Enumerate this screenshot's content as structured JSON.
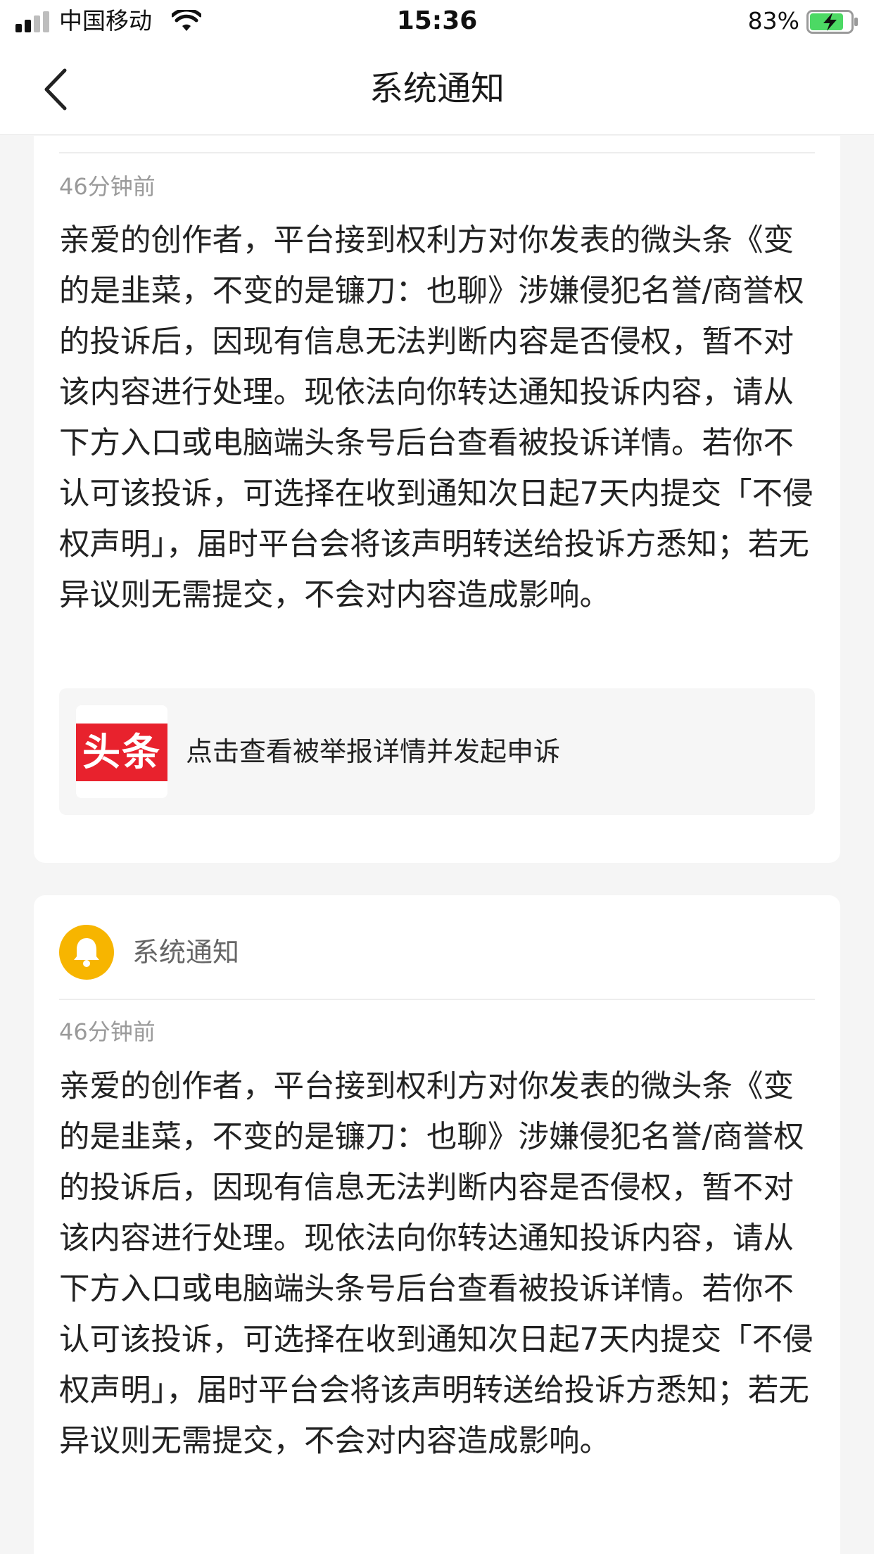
{
  "status_bar": {
    "carrier": "中国移动",
    "time": "15:36",
    "battery_percent": "83%",
    "battery_level": 0.83,
    "signal_bars": 2,
    "charging": true
  },
  "nav": {
    "title": "系统通知",
    "back_icon": "chevron-left-icon"
  },
  "notifications": [
    {
      "time": "46分钟前",
      "body": "亲爱的创作者，平台接到权利方对你发表的微头条《变的是韭菜，不变的是镰刀：也聊》涉嫌侵犯名誉/商誉权的投诉后，因现有信息无法判断内容是否侵权，暂不对该内容进行处理。现依法向你转达通知投诉内容，请从下方入口或电脑端头条号后台查看被投诉详情。若你不认可该投诉，可选择在收到通知次日起7天内提交「不侵权声明」，届时平台会将该声明转送给投诉方悉知；若无异议则无需提交，不会对内容造成影响。",
      "entry_logo_text": "头条",
      "entry_label": "点击查看被举报详情并发起申诉"
    },
    {
      "sender": "系统通知",
      "sender_icon": "bell-icon",
      "time": "46分钟前",
      "body": "亲爱的创作者，平台接到权利方对你发表的微头条《变的是韭菜，不变的是镰刀：也聊》涉嫌侵犯名誉/商誉权的投诉后，因现有信息无法判断内容是否侵权，暂不对该内容进行处理。现依法向你转达通知投诉内容，请从下方入口或电脑端头条号后台查看被投诉详情。若你不认可该投诉，可选择在收到通知次日起7天内提交「不侵权声明」，届时平台会将该声明转送给投诉方悉知；若无异议则无需提交，不会对内容造成影响。"
    }
  ],
  "colors": {
    "bell": "#f7b500",
    "logo_red": "#e8222d",
    "battery_green": "#4cd964"
  }
}
